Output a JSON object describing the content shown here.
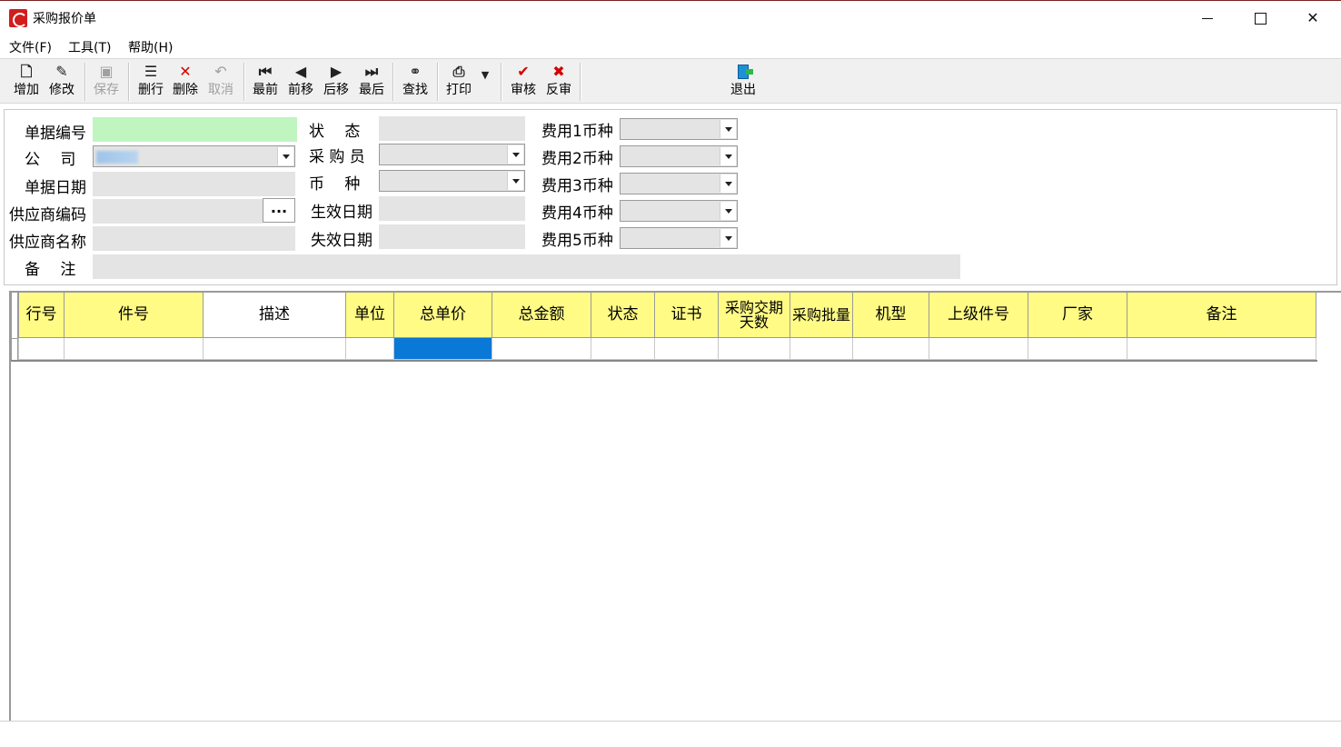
{
  "window": {
    "title": "采购报价单",
    "minimize_glyph": "",
    "maximize_glyph": "",
    "close_glyph": "✕"
  },
  "menu": {
    "items": [
      "文件(F)",
      "工具(T)",
      "帮助(H)"
    ]
  },
  "toolbar": {
    "add": "增加",
    "edit": "修改",
    "save": "保存",
    "delete_row": "删行",
    "delete": "删除",
    "cancel": "取消",
    "first": "最前",
    "prev": "前移",
    "next": "后移",
    "last": "最后",
    "find": "查找",
    "print": "打印",
    "audit": "审核",
    "unaudit": "反审",
    "exit": "退出"
  },
  "form": {
    "doc_no_label": "单据编号",
    "doc_no_value": "",
    "company_label": "公　 司",
    "company_value": "",
    "doc_date_label": "单据日期",
    "doc_date_value": "",
    "supplier_code_label": "供应商编码",
    "supplier_code_value": "",
    "supplier_code_button": "...",
    "supplier_name_label": "供应商名称",
    "supplier_name_value": "",
    "remark_label": "备　 注",
    "remark_value": "",
    "status_label": "状　 态",
    "status_value": "",
    "buyer_label": "采 购 员",
    "buyer_value": "",
    "currency_label": "币　 种",
    "currency_value": "",
    "effective_date_label": "生效日期",
    "effective_date_value": "",
    "expiry_date_label": "失效日期",
    "expiry_date_value": "",
    "fee1_label": "费用1币种",
    "fee2_label": "费用2币种",
    "fee3_label": "费用3币种",
    "fee4_label": "费用4币种",
    "fee5_label": "费用5币种"
  },
  "grid": {
    "columns": [
      "行号",
      "件号",
      "描述",
      "单位",
      "总单价",
      "总金额",
      "状态",
      "证书",
      "采购交期天数",
      "采购批量",
      "机型",
      "上级件号",
      "厂家",
      "备注"
    ],
    "rows": [
      [
        "",
        "",
        "",
        "",
        "",
        "",
        "",
        "",
        "",
        "",
        "",
        "",
        "",
        ""
      ]
    ],
    "selected_column": "总单价"
  },
  "colors": {
    "header_bg": "#fffb85",
    "doc_no_bg": "#c0f5c0",
    "selected_cell": "#0a78d7",
    "readonly_field": "#e4e4e4"
  }
}
